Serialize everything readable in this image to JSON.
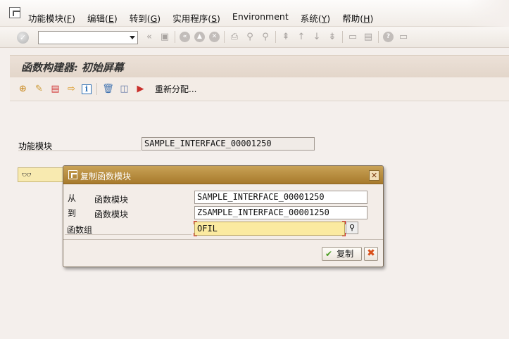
{
  "menu": {
    "items": [
      {
        "label": "功能模块",
        "accel": "F"
      },
      {
        "label": "编辑",
        "accel": "E"
      },
      {
        "label": "转到",
        "accel": "G"
      },
      {
        "label": "实用程序",
        "accel": "S"
      },
      {
        "label": "Environment",
        "accel": ""
      },
      {
        "label": "系统",
        "accel": "Y"
      },
      {
        "label": "帮助",
        "accel": "H"
      }
    ]
  },
  "toolbar": {
    "command_value": "",
    "icons": [
      "ok-icon",
      "back-icon",
      "save-icon",
      "back-arrow-icon",
      "exit-icon",
      "cancel-icon",
      "print-icon",
      "find-icon",
      "find-next-icon",
      "first-page-icon",
      "prev-page-icon",
      "next-page-icon",
      "last-page-icon",
      "new-session-icon",
      "shortcut-icon",
      "help-icon",
      "layout-icon"
    ]
  },
  "page": {
    "title": "函数构建器: 初始屏幕",
    "reassign_label": "重新分配..."
  },
  "main": {
    "function_module_label": "功能模块",
    "function_module_value": "SAMPLE_INTERFACE_00001250"
  },
  "dialog": {
    "title": "复制函数模块",
    "from_label": "从",
    "to_label": "到",
    "fm_label_from": "函数模块",
    "fm_label_to": "函数模块",
    "group_label": "函数组",
    "from_value": "SAMPLE_INTERFACE_00001250",
    "to_value": "ZSAMPLE_INTERFACE_00001250",
    "group_value": "OFIL",
    "ok_label": "复制",
    "close_glyph": "✕",
    "cancel_glyph": "✖"
  }
}
